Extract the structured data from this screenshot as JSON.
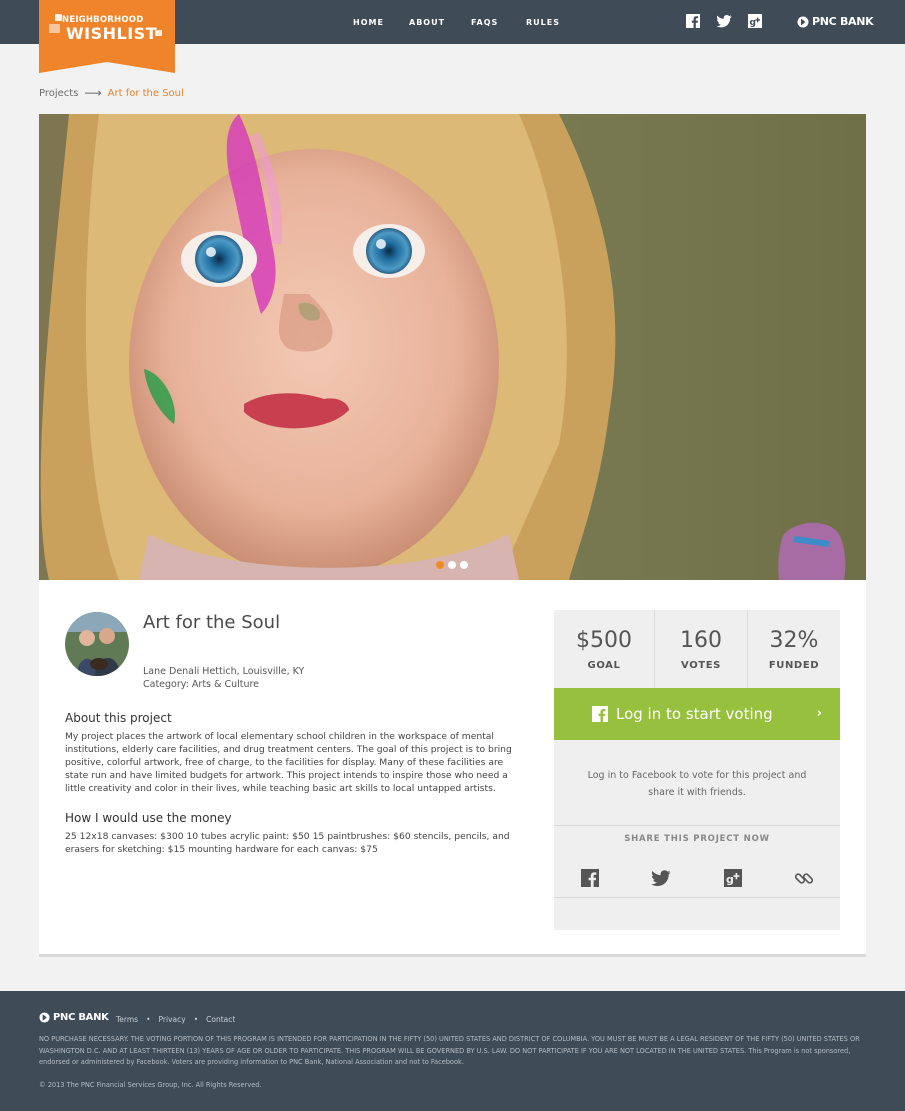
{
  "brand": {
    "logo_line1": "NEIGHBORHOOD",
    "logo_line2": "WISHLIST",
    "accent_color": "#F0842A",
    "bank_name": "PNC BANK"
  },
  "nav": {
    "items": [
      "HOME",
      "ABOUT",
      "FAQS",
      "RULES"
    ]
  },
  "social_top": [
    "facebook-icon",
    "twitter-icon",
    "google-plus-icon"
  ],
  "breadcrumb": {
    "parent": "Projects",
    "arrow": "⟶",
    "current": "Art for the Soul"
  },
  "carousel": {
    "slide_count": 3,
    "active_index": 0
  },
  "project": {
    "title": "Art for the Soul",
    "author_line": "Lane Denali Hettich, Louisville, KY",
    "category_line": "Category: Arts & Culture",
    "about_heading": "About this project",
    "about_text": "My project places the artwork of local elementary school children in the workspace of mental institutions, elderly care facilities, and drug treatment centers. The goal of this project is to bring positive, colorful artwork, free of charge, to the facilities for display. Many of these facilities are state run and have limited budgets for artwork. This project intends to inspire those who need a little creativity and color in their lives, while teaching basic art skills to local untapped artists.",
    "money_heading": "How I would use the money",
    "money_text": "25 12x18 canvases: $300 10 tubes acrylic paint: $50 15 paintbrushes: $60 stencils, pencils, and erasers for sketching: $15 mounting hardware for each canvas: $75"
  },
  "stats": [
    {
      "value": "$500",
      "label": "GOAL"
    },
    {
      "value": "160",
      "label": "VOTES"
    },
    {
      "value": "32%",
      "label": "FUNDED"
    }
  ],
  "vote": {
    "button_label": "Log in to start voting",
    "button_color": "#97C03F",
    "note": "Log in to Facebook to vote for this project and share it with friends.",
    "share_heading": "SHARE THIS PROJECT NOW",
    "share_icons": [
      "facebook-icon",
      "twitter-icon",
      "google-plus-icon",
      "link-icon"
    ]
  },
  "footer": {
    "bank_name": "PNC BANK",
    "links": [
      "Terms",
      "Privacy",
      "Contact"
    ],
    "separator": "•",
    "legal": "NO PURCHASE NECESSARY. THE VOTING PORTION OF THIS PROGRAM IS INTENDED FOR PARTICIPATION IN THE FIFTY (50) UNITED STATES AND DISTRICT OF COLUMBIA. YOU MUST BE MUST BE A LEGAL RESIDENT OF THE FIFTY (50) UNITED STATES OR WASHINGTON D.C. AND AT LEAST THIRTEEN (13) YEARS OF AGE OR OLDER TO PARTICIPATE. THIS PROGRAM WILL BE GOVERNED BY U.S. LAW. DO NOT PARTICIPATE IF YOU ARE NOT LOCATED IN THE UNITED STATES. This Program is not sponsored, endorsed or administered by Facebook. Voters are providing information to PNC Bank, National Association and not to Facebook.",
    "copyright": "© 2013 The PNC Financial Services Group, Inc. All Rights Reserved."
  }
}
